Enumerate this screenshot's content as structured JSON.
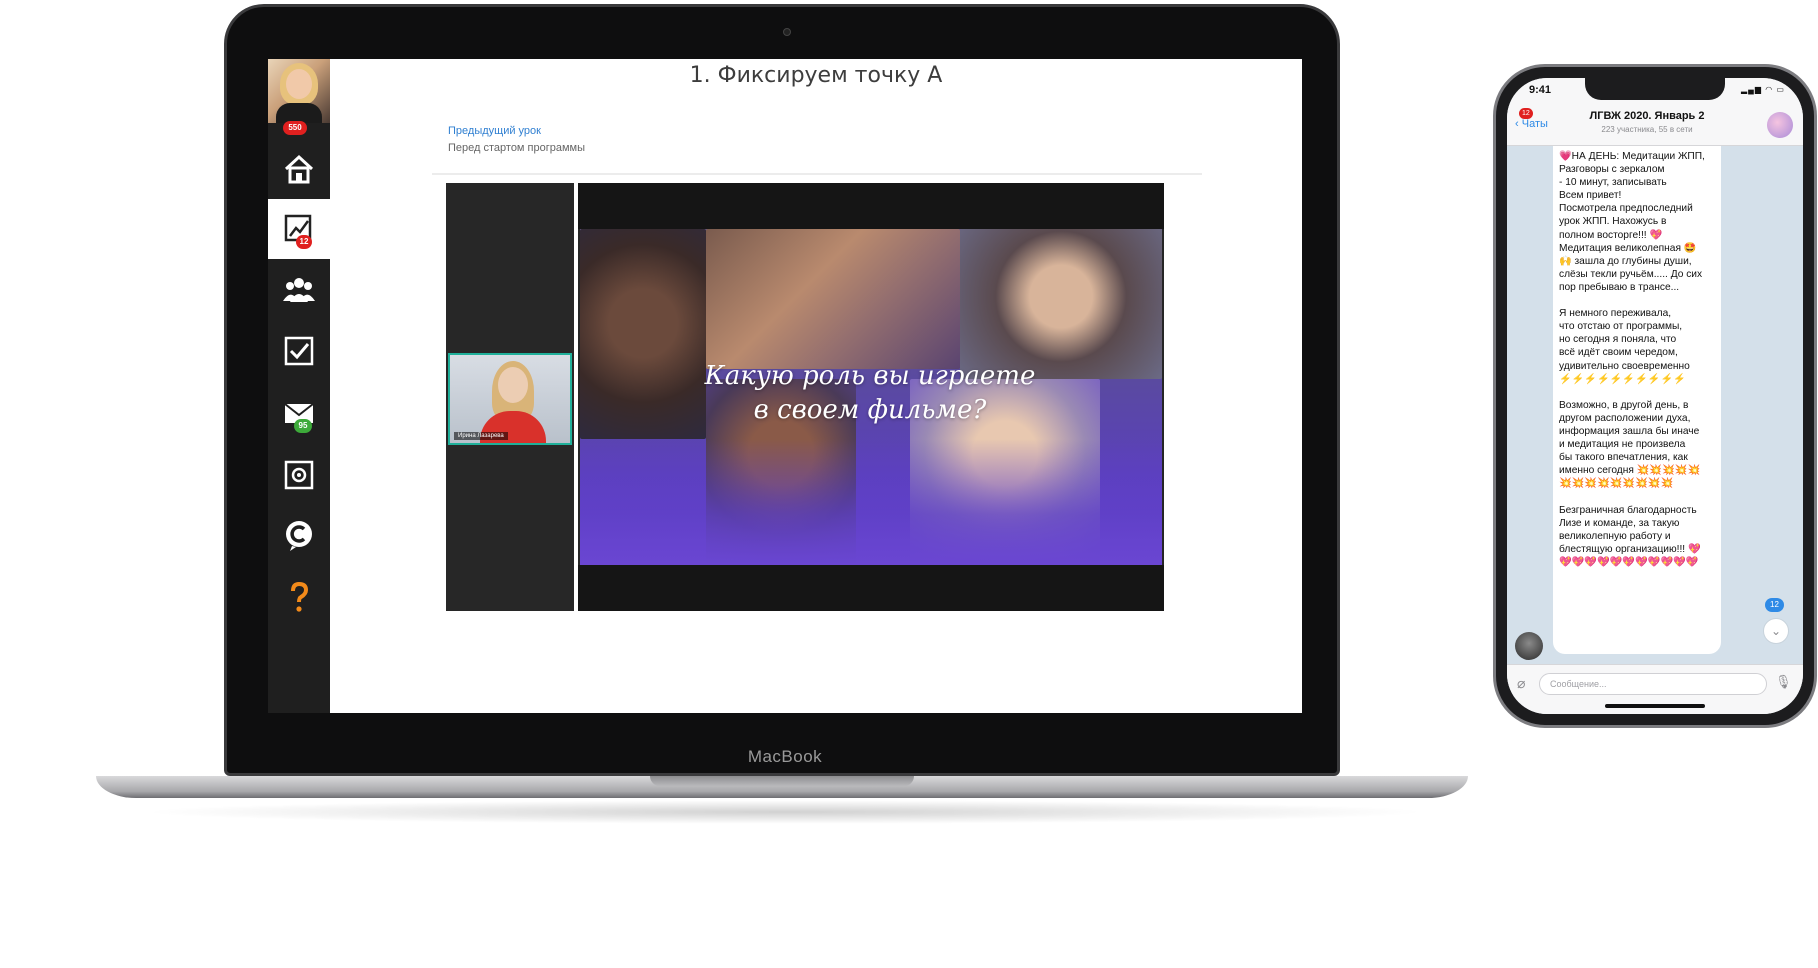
{
  "laptop": {
    "brand": "MacBook",
    "sidebar": {
      "avatar_badge": "550",
      "items": [
        {
          "icon": "home-icon",
          "badge": ""
        },
        {
          "icon": "chart-icon",
          "badge": "12",
          "active": true
        },
        {
          "icon": "community-icon",
          "badge": ""
        },
        {
          "icon": "checkbox-icon",
          "badge": ""
        },
        {
          "icon": "mail-icon",
          "badge": "95"
        },
        {
          "icon": "safe-icon",
          "badge": ""
        },
        {
          "icon": "copyright-icon",
          "badge": ""
        },
        {
          "icon": "question-icon",
          "badge": ""
        }
      ]
    },
    "page_title": "1. Фиксируем точку А",
    "prev_lesson": {
      "link": "Предыдущий урок",
      "subtitle": "Перед стартом программы"
    },
    "participant_label": "Ирина Лазарева",
    "video_title_line1": "Какую роль вы играете",
    "video_title_line2": "в своем фильме?"
  },
  "phone": {
    "time": "9:41",
    "back_label": "Чаты",
    "back_badge": "12",
    "chat_title": "ЛГВЖ 2020. Январь 2",
    "chat_subtitle": "223 участника, 55 в сети",
    "message_lines": [
      "💗НА ДЕНЬ: Медитации ЖПП,",
      "Разговоры с зеркалом",
      "- 10 минут, записывать",
      "Всем привет!",
      "Посмотрела предпоследний",
      "урок ЖПП. Нахожусь в",
      "полном восторге!!! 💖",
      "Медитация великолепная 🤩",
      "🙌 зашла до глубины души,",
      "слёзы текли ручьём..... До сих",
      "пор пребываю в трансе...",
      "",
      "Я немного переживала,",
      "что отстаю от программы,",
      "но сегодня я поняла, что",
      "всё идёт своим чередом,",
      "удивительно своевременно",
      "⚡⚡⚡⚡⚡⚡⚡⚡⚡⚡",
      "",
      "Возможно, в другой день, в",
      "другом расположении духа,",
      "информация зашла бы иначе",
      "и медитация не произвела",
      "бы такого впечатления, как",
      "именно сегодня 💥💥💥💥💥",
      "💥💥💥💥💥💥💥💥💥",
      "",
      "Безграничная благодарность",
      "Лизе и команде, за такую",
      "великолепную работу и",
      "блестящую организацию!!! 💖",
      "💖💖💖💖💖💖💖💖💖💖💖"
    ],
    "unread_count": "12",
    "input_placeholder": "Сообщение..."
  }
}
